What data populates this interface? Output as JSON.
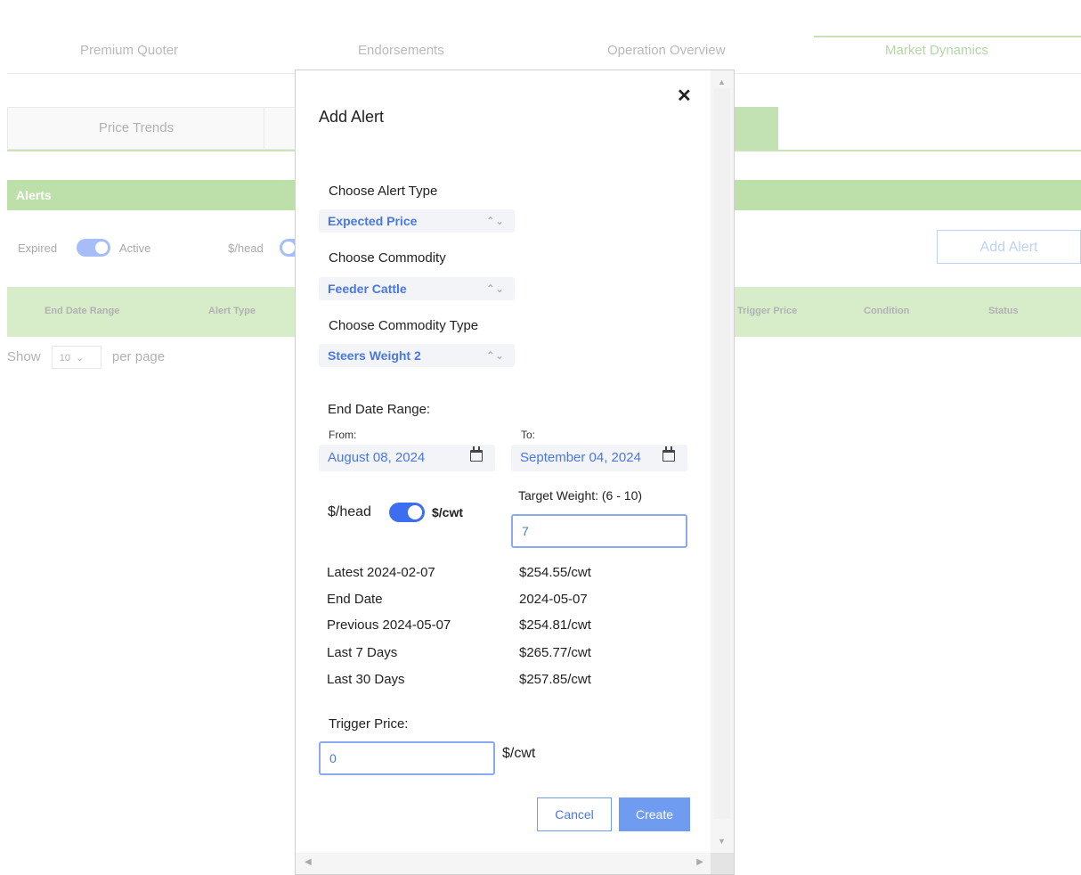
{
  "nav": {
    "tabs": [
      "Premium Quoter",
      "Endorsements",
      "Operation Overview",
      "Market Dynamics"
    ],
    "active_tab": "Market Dynamics"
  },
  "subnav": {
    "tabs": [
      "Price Trends"
    ]
  },
  "alerts_panel": {
    "title": "Alerts",
    "expired_label": "Expired",
    "active_label": "Active",
    "unit_label": "$/head",
    "add_alert_label": "Add Alert",
    "columns": [
      "End Date Range",
      "Alert Type",
      "Trigger Price",
      "Condition",
      "Status"
    ],
    "show_label": "Show",
    "per_page_value": "10",
    "per_page_label": "per page"
  },
  "modal": {
    "title": "Add Alert",
    "close_icon": "close-icon",
    "alert_type": {
      "label": "Choose Alert Type",
      "value": "Expected Price"
    },
    "commodity": {
      "label": "Choose Commodity",
      "value": "Feeder Cattle"
    },
    "commodity_type": {
      "label": "Choose Commodity Type",
      "value": "Steers Weight 2"
    },
    "end_date_range": {
      "label": "End Date Range:",
      "from_label": "From:",
      "from_value": "August 08, 2024",
      "to_label": "To:",
      "to_value": "September 04, 2024"
    },
    "unit_toggle": {
      "left_label": "$/head",
      "right_label": "$/cwt"
    },
    "target_weight": {
      "label": "Target Weight: (6 - 10)",
      "value": "7"
    },
    "stats": [
      {
        "label": "Latest 2024-02-07",
        "value": "$254.55/cwt"
      },
      {
        "label": "End Date",
        "value": "2024-05-07"
      },
      {
        "label": "Previous 2024-05-07",
        "value": "$254.81/cwt"
      },
      {
        "label": "Last 7 Days",
        "value": "$265.77/cwt"
      },
      {
        "label": "Last 30 Days",
        "value": "$257.85/cwt"
      }
    ],
    "trigger_price": {
      "label": "Trigger Price:",
      "value": "0",
      "unit": "$/cwt"
    },
    "cancel_label": "Cancel",
    "create_label": "Create"
  },
  "colors": {
    "accent": "#6f9bf0",
    "brand_green": "#6fbb45",
    "toggle_blue": "#3d6ef0"
  }
}
